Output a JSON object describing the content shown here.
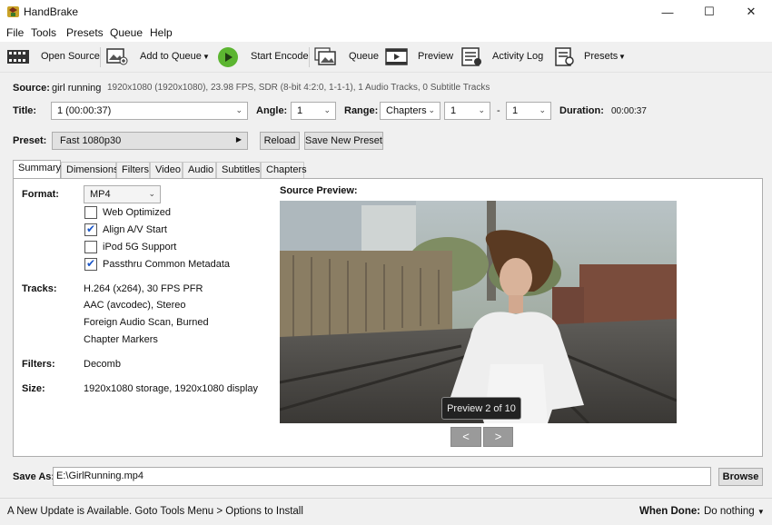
{
  "window": {
    "title": "HandBrake"
  },
  "menu": [
    "File",
    "Tools",
    "Presets",
    "Queue",
    "Help"
  ],
  "toolbar": {
    "open_source": "Open Source",
    "add_to_queue": "Add to Queue",
    "start_encode": "Start Encode",
    "queue": "Queue",
    "preview": "Preview",
    "activity_log": "Activity Log",
    "presets": "Presets"
  },
  "source": {
    "label": "Source:",
    "name": "girl running",
    "info": "1920x1080 (1920x1080), 23.98 FPS, SDR (8-bit 4:2:0, 1-1-1), 1 Audio Tracks, 0 Subtitle Tracks"
  },
  "title_row": {
    "title_label": "Title:",
    "title_value": "1  (00:00:37)",
    "angle_label": "Angle:",
    "angle_value": "1",
    "range_label": "Range:",
    "range_mode": "Chapters",
    "range_start": "1",
    "range_dash": "-",
    "range_end": "1",
    "duration_label": "Duration:",
    "duration_value": "00:00:37"
  },
  "preset": {
    "label": "Preset:",
    "value": "Fast 1080p30",
    "reload": "Reload",
    "save_new": "Save New Preset"
  },
  "tabs": [
    "Summary",
    "Dimensions",
    "Filters",
    "Video",
    "Audio",
    "Subtitles",
    "Chapters"
  ],
  "summary": {
    "format_label": "Format:",
    "format_value": "MP4",
    "options": [
      {
        "label": "Web Optimized",
        "checked": false
      },
      {
        "label": "Align A/V Start",
        "checked": true
      },
      {
        "label": "iPod 5G Support",
        "checked": false
      },
      {
        "label": "Passthru Common Metadata",
        "checked": true
      }
    ],
    "tracks_label": "Tracks:",
    "tracks": [
      "H.264 (x264), 30 FPS PFR",
      "AAC (avcodec), Stereo",
      "Foreign Audio Scan, Burned",
      "Chapter Markers"
    ],
    "filters_label": "Filters:",
    "filters_value": "Decomb",
    "size_label": "Size:",
    "size_value": "1920x1080 storage, 1920x1080 display",
    "source_preview_label": "Source Preview:",
    "preview_counter": "Preview 2 of 10",
    "prev": "<",
    "next": ">"
  },
  "save_as": {
    "label": "Save As:",
    "value": "E:\\GirlRunning.mp4",
    "browse": "Browse"
  },
  "status": {
    "message": "A New Update is Available. Goto Tools Menu > Options to Install",
    "when_done_label": "When Done:",
    "when_done_value": "Do nothing"
  }
}
